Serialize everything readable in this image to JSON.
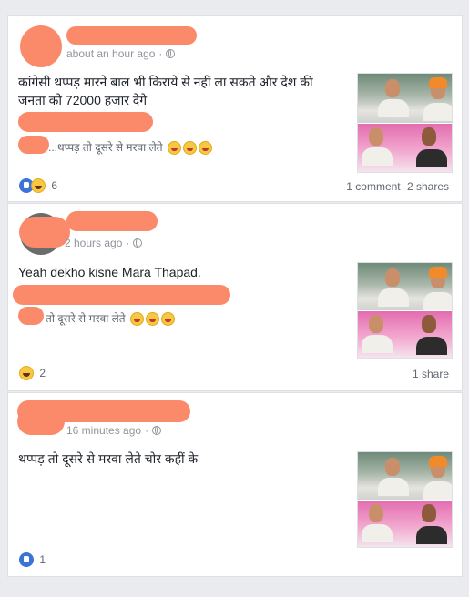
{
  "posts": [
    {
      "time": "about an hour ago",
      "dot": "·",
      "body_line1": "कांगेसी थप्पड़ मारने बाल भी किराये से नहीं ला सकते और देश की",
      "body_line2": "जनता को 72000 हजार देगे",
      "quote": "...थप्पड़ तो दूसरे से मरवा लेते",
      "reactions_count": "6",
      "comments": "1 comment",
      "shares": "2 shares"
    },
    {
      "time": "2 hours ago",
      "dot": "·",
      "body_line1": "Yeah dekho kisne Mara Thapad.",
      "quote": "तो दूसरे से मरवा लेते",
      "reactions_count": "2",
      "shares": "1 share"
    },
    {
      "time": "16 minutes ago",
      "dot": "·",
      "body_line1": "थप्पड़ तो दूसरे से मरवा लेते चोर कहीं के",
      "reactions_count": "1"
    }
  ],
  "icons": {
    "privacy": "globe-icon",
    "like": "like-reaction-icon",
    "haha": "haha-reaction-icon"
  },
  "colors": {
    "redaction": "#fb8a6a",
    "meta_text": "#90949c",
    "like_blue": "#3b73d6"
  }
}
